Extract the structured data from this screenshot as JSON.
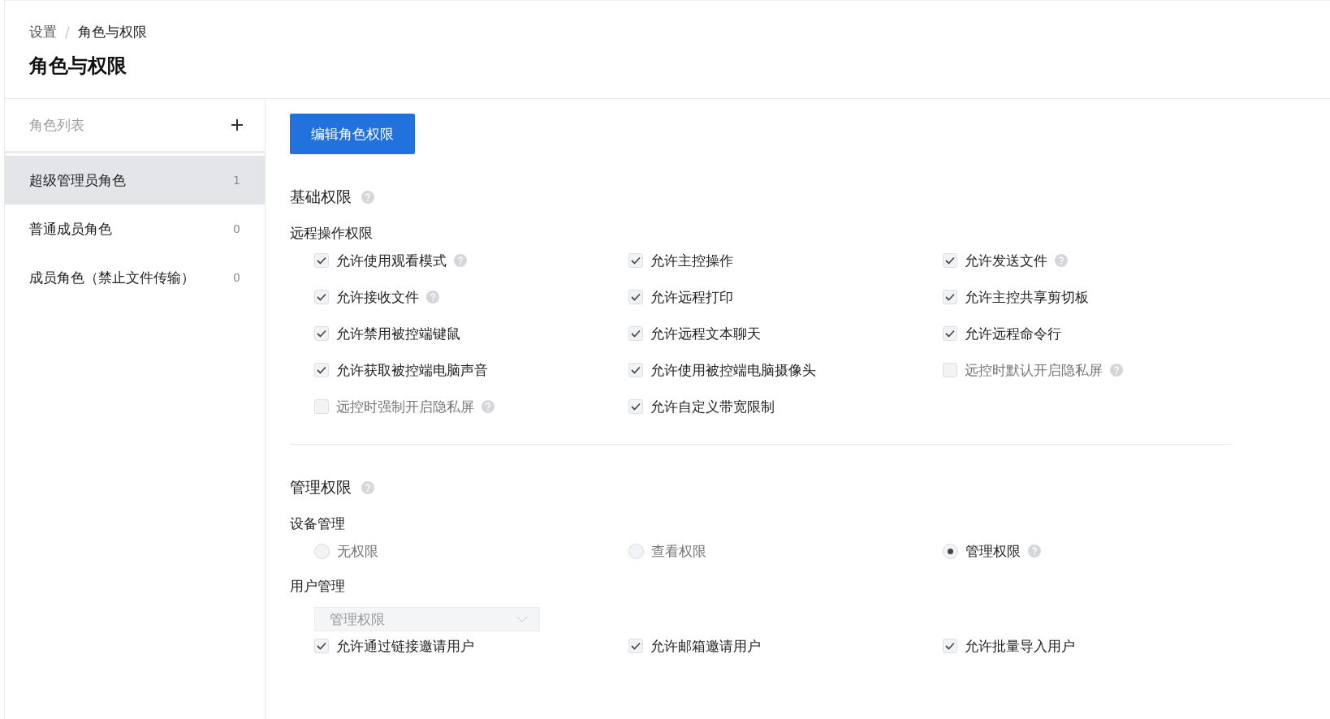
{
  "breadcrumb": [
    {
      "label": "设置"
    },
    {
      "label": "角色与权限"
    }
  ],
  "breadcrumb_separator": "/",
  "page_title": "角色与权限",
  "sidebar": {
    "title": "角色列表",
    "roles": [
      {
        "name": "超级管理员角色",
        "count": "1",
        "selected": true
      },
      {
        "name": "普通成员角色",
        "count": "0",
        "selected": false
      },
      {
        "name": "成员角色（禁止文件传输）",
        "count": "0",
        "selected": false
      }
    ]
  },
  "edit_button": "编辑角色权限",
  "sections": [
    {
      "title": "基础权限",
      "help": true,
      "groups": [
        {
          "title": "远程操作权限",
          "kind": "checkboxes",
          "items": [
            {
              "label": "允许使用观看模式",
              "checked": true,
              "help": true
            },
            {
              "label": "允许主控操作",
              "checked": true,
              "help": false
            },
            {
              "label": "允许发送文件",
              "checked": true,
              "help": true
            },
            {
              "label": "允许接收文件",
              "checked": true,
              "help": true
            },
            {
              "label": "允许远程打印",
              "checked": true,
              "help": false
            },
            {
              "label": "允许主控共享剪切板",
              "checked": true,
              "help": false
            },
            {
              "label": "允许禁用被控端键鼠",
              "checked": true,
              "help": false
            },
            {
              "label": "允许远程文本聊天",
              "checked": true,
              "help": false
            },
            {
              "label": "允许远程命令行",
              "checked": true,
              "help": false
            },
            {
              "label": "允许获取被控端电脑声音",
              "checked": true,
              "help": false
            },
            {
              "label": "允许使用被控端电脑摄像头",
              "checked": true,
              "help": false
            },
            {
              "label": "远控时默认开启隐私屏",
              "checked": false,
              "help": true
            },
            {
              "label": "远控时强制开启隐私屏",
              "checked": false,
              "help": true
            },
            {
              "label": "允许自定义带宽限制",
              "checked": true,
              "help": false
            }
          ]
        }
      ]
    },
    {
      "title": "管理权限",
      "help": true,
      "groups": [
        {
          "title": "设备管理",
          "kind": "radios",
          "items": [
            {
              "label": "无权限",
              "selected": false,
              "help": false
            },
            {
              "label": "查看权限",
              "selected": false,
              "help": false
            },
            {
              "label": "管理权限",
              "selected": true,
              "help": true
            }
          ]
        },
        {
          "title": "用户管理",
          "kind": "checkboxes",
          "select": {
            "value": "管理权限"
          },
          "items": [
            {
              "label": "允许通过链接邀请用户",
              "checked": true,
              "help": false
            },
            {
              "label": "允许邮箱邀请用户",
              "checked": true,
              "help": false
            },
            {
              "label": "允许批量导入用户",
              "checked": true,
              "help": false
            }
          ]
        }
      ]
    }
  ]
}
